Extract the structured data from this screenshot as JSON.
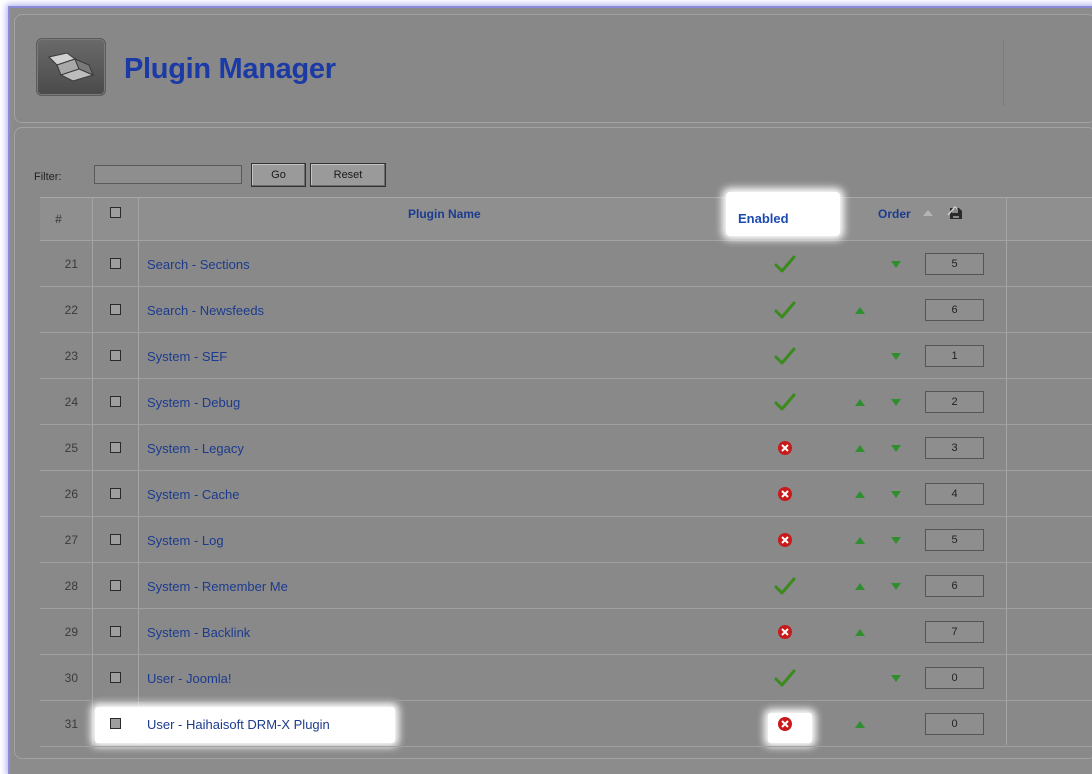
{
  "header": {
    "title": "Plugin Manager",
    "icon": "plugin-icon"
  },
  "filter": {
    "label": "Filter:",
    "value": "",
    "go_label": "Go",
    "reset_label": "Reset"
  },
  "table": {
    "columns": {
      "num": "#",
      "name": "Plugin Name",
      "enabled": "Enabled",
      "order": "Order"
    },
    "rows": [
      {
        "num": "21",
        "name": "Search - Sections",
        "enabled": "check",
        "up": false,
        "down": true,
        "order": "5"
      },
      {
        "num": "22",
        "name": "Search - Newsfeeds",
        "enabled": "check",
        "up": true,
        "down": false,
        "order": "6"
      },
      {
        "num": "23",
        "name": "System - SEF",
        "enabled": "check",
        "up": false,
        "down": true,
        "order": "1"
      },
      {
        "num": "24",
        "name": "System - Debug",
        "enabled": "check",
        "up": true,
        "down": true,
        "order": "2"
      },
      {
        "num": "25",
        "name": "System - Legacy",
        "enabled": "x",
        "up": true,
        "down": true,
        "order": "3"
      },
      {
        "num": "26",
        "name": "System - Cache",
        "enabled": "x",
        "up": true,
        "down": true,
        "order": "4"
      },
      {
        "num": "27",
        "name": "System - Log",
        "enabled": "x",
        "up": true,
        "down": true,
        "order": "5"
      },
      {
        "num": "28",
        "name": "System - Remember Me",
        "enabled": "check",
        "up": true,
        "down": true,
        "order": "6"
      },
      {
        "num": "29",
        "name": "System - Backlink",
        "enabled": "x",
        "up": true,
        "down": false,
        "order": "7"
      },
      {
        "num": "30",
        "name": "User - Joomla!",
        "enabled": "check",
        "up": false,
        "down": true,
        "order": "0"
      },
      {
        "num": "31",
        "name": "User - Haihaisoft DRM-X Plugin",
        "enabled": "x",
        "up": true,
        "down": false,
        "order": "0"
      }
    ]
  },
  "colors": {
    "accent": "#1b3aa6",
    "link": "#1c3b8f",
    "check": "#3a8a1c",
    "disabled": "#c81a1a",
    "arrow": "#2f8f2f"
  }
}
